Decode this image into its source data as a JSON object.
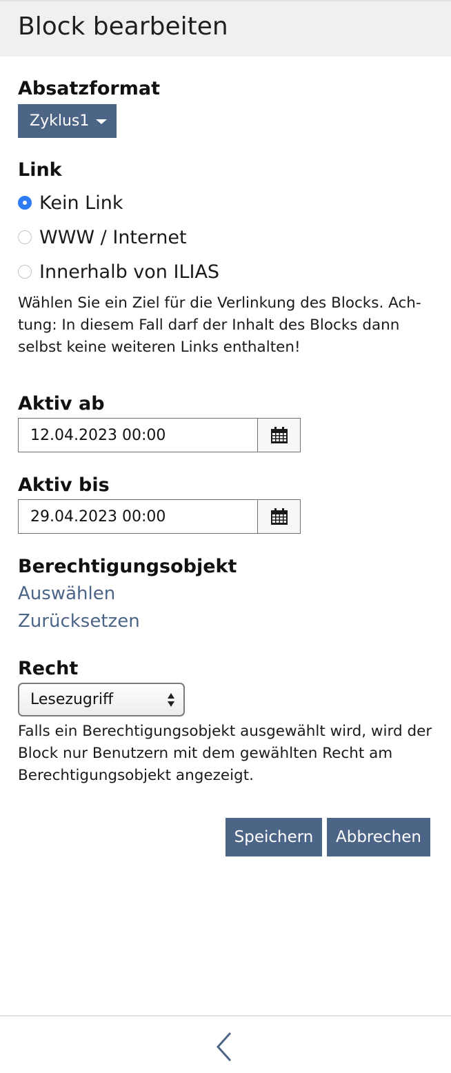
{
  "header": {
    "title": "Block bearbeiten"
  },
  "paragraph_format": {
    "label": "Absatzformat",
    "selected": "Zyklus1"
  },
  "link": {
    "label": "Link",
    "options": [
      {
        "label": "Kein Link",
        "checked": true
      },
      {
        "label": "WWW / Internet",
        "checked": false
      },
      {
        "label": "Innerhalb von ILIAS",
        "checked": false
      }
    ],
    "help": "Wählen Sie ein Ziel für die Verlinkung des Blocks. Ach­tung: In diesem Fall darf der Inhalt des Blocks dann selbst keine weiteren Links enthalten!"
  },
  "active_from": {
    "label": "Aktiv ab",
    "value": "12.04.2023 00:00"
  },
  "active_until": {
    "label": "Aktiv bis",
    "value": "29.04.2023 00:00"
  },
  "permission_object": {
    "label": "Berechtigungsobjekt",
    "select_link": "Auswählen",
    "reset_link": "Zurücksetzen"
  },
  "right": {
    "label": "Recht",
    "selected": "Lesezugriff",
    "help": "Falls ein Berechtigungsobjekt ausgewählt wird, wird der Block nur Benutzern mit dem gewählten Recht am Berechtigungsobjekt angezeigt."
  },
  "buttons": {
    "save": "Speichern",
    "cancel": "Abbrechen"
  },
  "colors": {
    "accent": "#4c6586",
    "radio_checked": "#2f7bf5",
    "header_bg": "#f0f0f0"
  },
  "icons": {
    "calendar": "calendar-icon",
    "caret": "caret-down-icon",
    "select_arrows": "select-arrows-icon",
    "back": "chevron-left-icon"
  }
}
